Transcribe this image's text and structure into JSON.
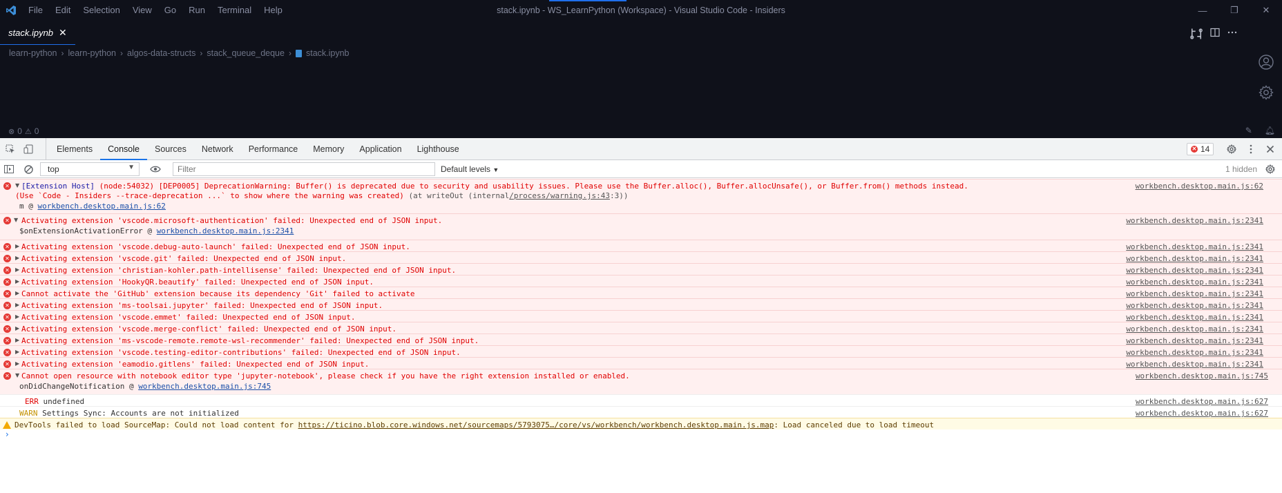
{
  "window": {
    "title": "stack.ipynb - WS_LearnPython (Workspace) - Visual Studio Code - Insiders",
    "menu": [
      "File",
      "Edit",
      "Selection",
      "View",
      "Go",
      "Run",
      "Terminal",
      "Help"
    ],
    "controls": {
      "minimize": "—",
      "maximize": "❐",
      "close": "✕"
    }
  },
  "editor": {
    "tab": {
      "label": "stack.ipynb",
      "close": "✕"
    },
    "breadcrumb": [
      "learn-python",
      "learn-python",
      "algos-data-structs",
      "stack_queue_deque",
      "stack.ipynb"
    ],
    "breadcrumb_sep": "›"
  },
  "statusbar": {
    "errors": "0",
    "warnings": "0"
  },
  "devtools": {
    "tabs": [
      "Elements",
      "Console",
      "Sources",
      "Network",
      "Performance",
      "Memory",
      "Application",
      "Lighthouse"
    ],
    "active_tab": "Console",
    "error_count": "14",
    "context": "top",
    "filter_placeholder": "Filter",
    "levels": "Default levels",
    "hidden": "1 hidden"
  },
  "console": {
    "row0": {
      "line1_blue": "[Extension Host]",
      "line1": " (node:54032) [DEP0005] DeprecationWarning: Buffer() is deprecated due to security and usability issues. Please use the Buffer.alloc(), Buffer.allocUnsafe(), or Buffer.from() methods instead.",
      "line2": "(Use `Code - Insiders --trace-deprecation ...` to show where the warning was created)",
      "line2_gray_a": " (at writeOut (internal",
      "line2_link": "/process/warning.js:43",
      "line2_gray_b": ":3))",
      "stack_prefix": "m @ ",
      "stack_link": "workbench.desktop.main.js:62",
      "src": "workbench.desktop.main.js:62"
    },
    "row1": {
      "msg": "Activating extension 'vscode.microsoft-authentication' failed: Unexpected end of JSON input.",
      "stack_prefix": "$onExtensionActivationError @ ",
      "stack_link": "workbench.desktop.main.js:2341",
      "src": "workbench.desktop.main.js:2341"
    },
    "collapsed": [
      {
        "msg": "Activating extension 'vscode.debug-auto-launch' failed: Unexpected end of JSON input.",
        "src": "workbench.desktop.main.js:2341"
      },
      {
        "msg": "Activating extension 'vscode.git' failed: Unexpected end of JSON input.",
        "src": "workbench.desktop.main.js:2341"
      },
      {
        "msg": "Activating extension 'christian-kohler.path-intellisense' failed: Unexpected end of JSON input.",
        "src": "workbench.desktop.main.js:2341"
      },
      {
        "msg": "Activating extension 'HookyQR.beautify' failed: Unexpected end of JSON input.",
        "src": "workbench.desktop.main.js:2341"
      },
      {
        "msg": "Cannot activate the 'GitHub' extension because its dependency 'Git' failed to activate",
        "src": "workbench.desktop.main.js:2341"
      },
      {
        "msg": "Activating extension 'ms-toolsai.jupyter' failed: Unexpected end of JSON input.",
        "src": "workbench.desktop.main.js:2341"
      },
      {
        "msg": "Activating extension 'vscode.emmet' failed: Unexpected end of JSON input.",
        "src": "workbench.desktop.main.js:2341"
      },
      {
        "msg": "Activating extension 'vscode.merge-conflict' failed: Unexpected end of JSON input.",
        "src": "workbench.desktop.main.js:2341"
      },
      {
        "msg": "Activating extension 'ms-vscode-remote.remote-wsl-recommender' failed: Unexpected end of JSON input.",
        "src": "workbench.desktop.main.js:2341"
      },
      {
        "msg": "Activating extension 'vscode.testing-editor-contributions' failed: Unexpected end of JSON input.",
        "src": "workbench.desktop.main.js:2341"
      },
      {
        "msg": "Activating extension 'eamodio.gitlens' failed: Unexpected end of JSON input.",
        "src": "workbench.desktop.main.js:2341"
      }
    ],
    "row_notebook": {
      "msg": "Cannot open resource with notebook editor type 'jupyter-notebook', please check if you have the right extension installed or enabled.",
      "stack_prefix": "onDidChangeNotification @ ",
      "stack_link": "workbench.desktop.main.js:745",
      "src": "workbench.desktop.main.js:745"
    },
    "row_err": {
      "tag": "ERR",
      "msg": " undefined",
      "src": "workbench.desktop.main.js:627"
    },
    "row_warn": {
      "tag": "WARN",
      "msg": " Settings Sync: Accounts are not initialized",
      "src": "workbench.desktop.main.js:627"
    },
    "row_sourcemap": {
      "pre": "DevTools failed to load SourceMap: Could not load content for ",
      "link": "https://ticino.blob.core.windows.net/sourcemaps/5793075…/core/vs/workbench/workbench.desktop.main.js.map",
      "post": ": Load canceled due to load timeout"
    },
    "prompt": "›"
  },
  "colors": {
    "vscode_bg": "#0f111a",
    "accent": "#1f6feb",
    "error": "#e00000",
    "error_bg": "#fff0f0"
  },
  "icons": [
    "vscode-logo-icon",
    "compare-icon",
    "split-editor-icon",
    "more-icon",
    "account-icon",
    "settings-gear-icon",
    "inspect-icon",
    "device-toggle-icon",
    "sidebar-toggle-icon",
    "clear-console-icon",
    "eye-icon",
    "close-icon"
  ]
}
